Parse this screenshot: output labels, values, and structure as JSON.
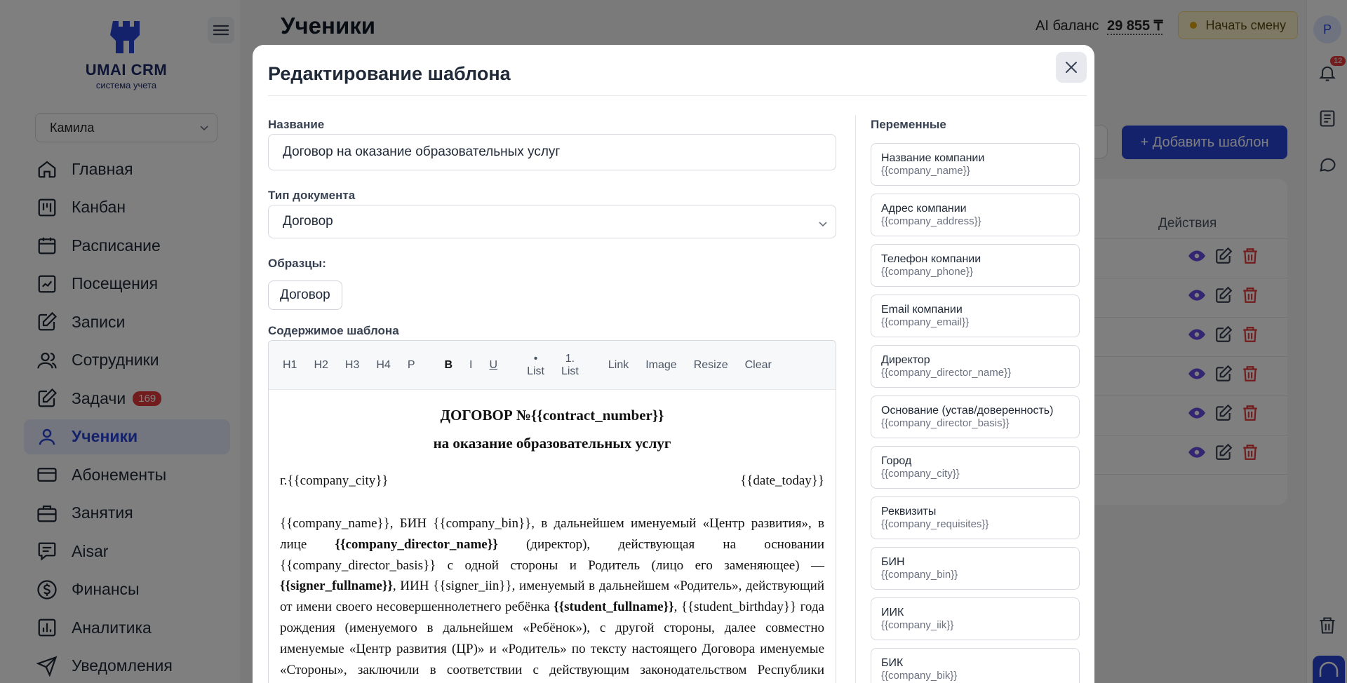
{
  "brand": {
    "title": "UMAI CRM",
    "subtitle": "система учета"
  },
  "sidebar": {
    "branch": "Камила",
    "items": [
      {
        "label": "Главная",
        "icon": "home-icon"
      },
      {
        "label": "Канбан",
        "icon": "kanban-icon"
      },
      {
        "label": "Расписание",
        "icon": "calendar-icon"
      },
      {
        "label": "Посещения",
        "icon": "chart-check-icon"
      },
      {
        "label": "Записи",
        "icon": "edit-icon"
      },
      {
        "label": "Сотрудники",
        "icon": "users-icon"
      },
      {
        "label": "Задачи",
        "icon": "task-icon",
        "badge": "169"
      },
      {
        "label": "Ученики",
        "icon": "user-icon",
        "active": true
      },
      {
        "label": "Абонементы",
        "icon": "card-icon"
      },
      {
        "label": "Занятия",
        "icon": "briefcase-icon"
      },
      {
        "label": "Aisar",
        "icon": "chat-icon"
      },
      {
        "label": "Финансы",
        "icon": "dollar-icon"
      },
      {
        "label": "Аналитика",
        "icon": "analytics-icon"
      },
      {
        "label": "Уведомления",
        "icon": "send-icon"
      }
    ]
  },
  "header": {
    "title": "Ученики",
    "ai_balance_label": "AI баланс",
    "ai_balance_value": "29 855 ₸",
    "start_shift": "Начать смену",
    "avatar_letter": "P",
    "notifications_count": "12"
  },
  "background": {
    "add_template": "+ Добавить шаблон",
    "actions_header": "Действия"
  },
  "modal": {
    "title": "Редактирование шаблона",
    "name_label": "Название",
    "name_value": "Договор на оказание образовательных услуг",
    "doc_type_label": "Тип документа",
    "doc_type_value": "Договор",
    "samples_label": "Образцы:",
    "sample_button": "Договор",
    "content_label": "Содержимое шаблона",
    "toolbar": {
      "h1": "H1",
      "h2": "H2",
      "h3": "H3",
      "h4": "H4",
      "p": "P",
      "bold": "B",
      "italic": "I",
      "underline": "U",
      "bullet_a": "•",
      "bullet_b": "List",
      "ordered_a": "1.",
      "ordered_b": "List",
      "link": "Link",
      "image": "Image",
      "resize": "Resize",
      "clear": "Clear"
    },
    "document": {
      "heading1": "ДОГОВОР №{{contract_number}}",
      "heading2": "на оказание образовательных услуг",
      "city": "г.{{company_city}}",
      "date": "{{date_today}}",
      "p_1": "{{company_name}}, БИН {{company_bin}}, в дальнейшем именуемый «Центр развития», в лице ",
      "p_director": "{{company_director_name}}",
      "p_2": " (директор), действующая на основании {{company_director_basis}} с одной стороны и Родитель (лицо его заменяющее) — ",
      "p_signer": "{{signer_fullname}}",
      "p_3": ", ИИН {{signer_iin}}, именуемый в дальнейшем «Родитель», действующий от имени своего несовершеннолетнего ребёнка ",
      "p_student": "{{student_fullname}}",
      "p_4": ", {{student_birthday}} года рождения (именуемого в дальнейшем «Ребёнок»), с другой стороны, далее совместно именуемые «Центр развития (ЦР)» и «Родитель» по тексту настоящего Договора именуемые «Стороны», заключили в соответствии с действующим законодательством Республики Казахстан настоящий Договор по содержанию,"
    },
    "variables_title": "Переменные",
    "variables": [
      {
        "name": "Название компании",
        "code": "{{company_name}}"
      },
      {
        "name": "Адрес компании",
        "code": "{{company_address}}"
      },
      {
        "name": "Телефон компании",
        "code": "{{company_phone}}"
      },
      {
        "name": "Email компании",
        "code": "{{company_email}}"
      },
      {
        "name": "Директор",
        "code": "{{company_director_name}}"
      },
      {
        "name": "Основание (устав/доверенность)",
        "code": "{{company_director_basis}}"
      },
      {
        "name": "Город",
        "code": "{{company_city}}"
      },
      {
        "name": "Реквизиты",
        "code": "{{company_requisites}}"
      },
      {
        "name": "БИН",
        "code": "{{company_bin}}"
      },
      {
        "name": "ИИК",
        "code": "{{company_iik}}"
      },
      {
        "name": "БИК",
        "code": "{{company_bik}}"
      }
    ]
  }
}
